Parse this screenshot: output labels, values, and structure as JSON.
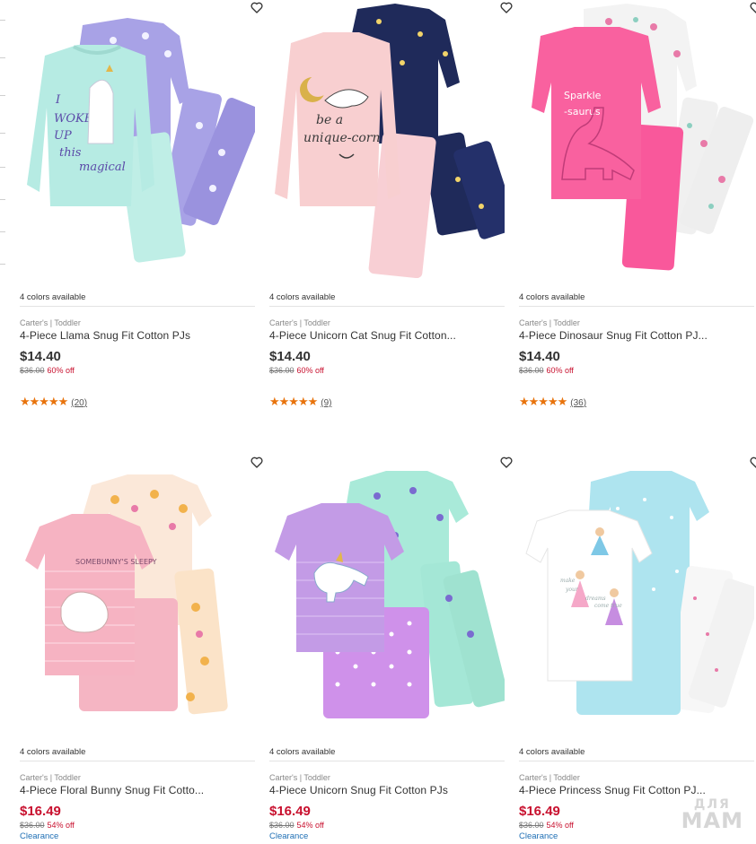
{
  "colors": {
    "accent_red": "#c8102e",
    "rating_orange": "#e8730c",
    "link_blue": "#1f6fb5"
  },
  "products": [
    {
      "colors_available": "4 colors available",
      "brand": "Carter's | Toddler",
      "name": "4-Piece Llama Snug Fit Cotton PJs",
      "price": "$14.40",
      "was_price": "$36.00",
      "discount": "60% off",
      "stars": "★★★★★",
      "review_count": "(20)",
      "image": "llama-pajama-set"
    },
    {
      "colors_available": "4 colors available",
      "brand": "Carter's | Toddler",
      "name": "4-Piece Unicorn Cat Snug Fit Cotton...",
      "price": "$14.40",
      "was_price": "$36.00",
      "discount": "60% off",
      "stars": "★★★★★",
      "review_count": "(9)",
      "image": "unicorn-cat-pajama-set"
    },
    {
      "colors_available": "4 colors available",
      "brand": "Carter's | Toddler",
      "name": "4-Piece Dinosaur Snug Fit Cotton PJ...",
      "price": "$14.40",
      "was_price": "$36.00",
      "discount": "60% off",
      "stars": "★★★★★",
      "review_count": "(36)",
      "image": "dinosaur-pajama-set"
    },
    {
      "colors_available": "4 colors available",
      "brand": "Carter's | Toddler",
      "name": "4-Piece Floral Bunny Snug Fit Cotto...",
      "price": "$16.49",
      "was_price": "$36.00",
      "discount": "54% off",
      "badge": "Clearance",
      "image": "floral-bunny-pajama-set"
    },
    {
      "colors_available": "4 colors available",
      "brand": "Carter's | Toddler",
      "name": "4-Piece Unicorn Snug Fit Cotton PJs",
      "price": "$16.49",
      "was_price": "$36.00",
      "discount": "54% off",
      "badge": "Clearance",
      "image": "unicorn-pajama-set"
    },
    {
      "colors_available": "4 colors available",
      "brand": "Carter's | Toddler",
      "name": "4-Piece Princess Snug Fit Cotton PJ...",
      "price": "$16.49",
      "was_price": "$36.00",
      "discount": "54% off",
      "badge": "Clearance",
      "image": "princess-pajama-set"
    }
  ],
  "watermark": {
    "line1": "ДЛЯ",
    "line2": "МАМ"
  }
}
